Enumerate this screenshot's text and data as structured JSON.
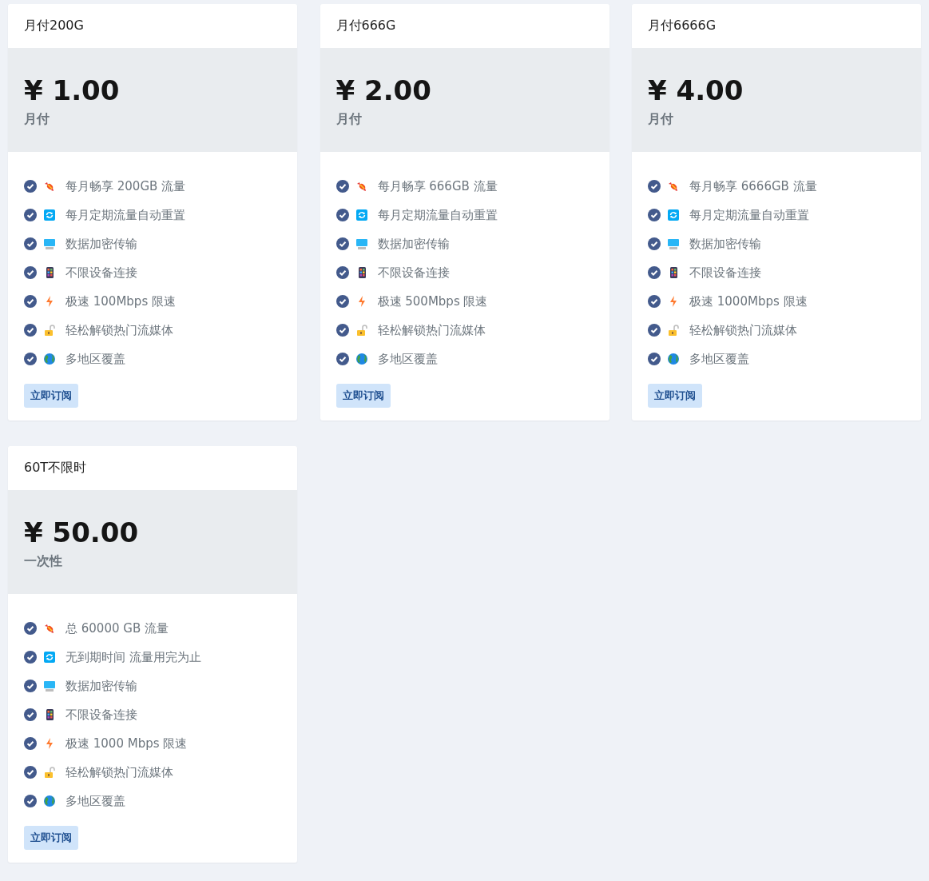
{
  "plans": [
    {
      "title": "月付200G",
      "price": "¥ 1.00",
      "period": "月付",
      "features": [
        {
          "kind": "traffic",
          "text": "每月畅享 200GB 流量"
        },
        {
          "kind": "reset",
          "text": "每月定期流量自动重置"
        },
        {
          "kind": "encryption",
          "text": "数据加密传输"
        },
        {
          "kind": "devices",
          "text": "不限设备连接"
        },
        {
          "kind": "speed",
          "text": "极速 100Mbps 限速"
        },
        {
          "kind": "unlock",
          "text": "轻松解锁热门流媒体"
        },
        {
          "kind": "regions",
          "text": "多地区覆盖"
        }
      ],
      "button": "立即订阅"
    },
    {
      "title": "月付666G",
      "price": "¥ 2.00",
      "period": "月付",
      "features": [
        {
          "kind": "traffic",
          "text": "每月畅享 666GB 流量"
        },
        {
          "kind": "reset",
          "text": "每月定期流量自动重置"
        },
        {
          "kind": "encryption",
          "text": "数据加密传输"
        },
        {
          "kind": "devices",
          "text": "不限设备连接"
        },
        {
          "kind": "speed",
          "text": "极速 500Mbps 限速"
        },
        {
          "kind": "unlock",
          "text": "轻松解锁热门流媒体"
        },
        {
          "kind": "regions",
          "text": "多地区覆盖"
        }
      ],
      "button": "立即订阅"
    },
    {
      "title": "月付6666G",
      "price": "¥ 4.00",
      "period": "月付",
      "features": [
        {
          "kind": "traffic",
          "text": "每月畅享 6666GB 流量"
        },
        {
          "kind": "reset",
          "text": "每月定期流量自动重置"
        },
        {
          "kind": "encryption",
          "text": "数据加密传输"
        },
        {
          "kind": "devices",
          "text": "不限设备连接"
        },
        {
          "kind": "speed",
          "text": "极速 1000Mbps 限速"
        },
        {
          "kind": "unlock",
          "text": "轻松解锁热门流媒体"
        },
        {
          "kind": "regions",
          "text": "多地区覆盖"
        }
      ],
      "button": "立即订阅"
    },
    {
      "title": "60T不限时",
      "price": "¥ 50.00",
      "period": "一次性",
      "features": [
        {
          "kind": "traffic",
          "text": "总 60000 GB 流量"
        },
        {
          "kind": "reset",
          "text": "无到期时间 流量用完为止"
        },
        {
          "kind": "encryption",
          "text": "数据加密传输"
        },
        {
          "kind": "devices",
          "text": "不限设备连接"
        },
        {
          "kind": "speed",
          "text": "极速 1000 Mbps 限速"
        },
        {
          "kind": "unlock",
          "text": "轻松解锁热门流媒体"
        },
        {
          "kind": "regions",
          "text": "多地区覆盖"
        }
      ],
      "button": "立即订阅"
    }
  ]
}
